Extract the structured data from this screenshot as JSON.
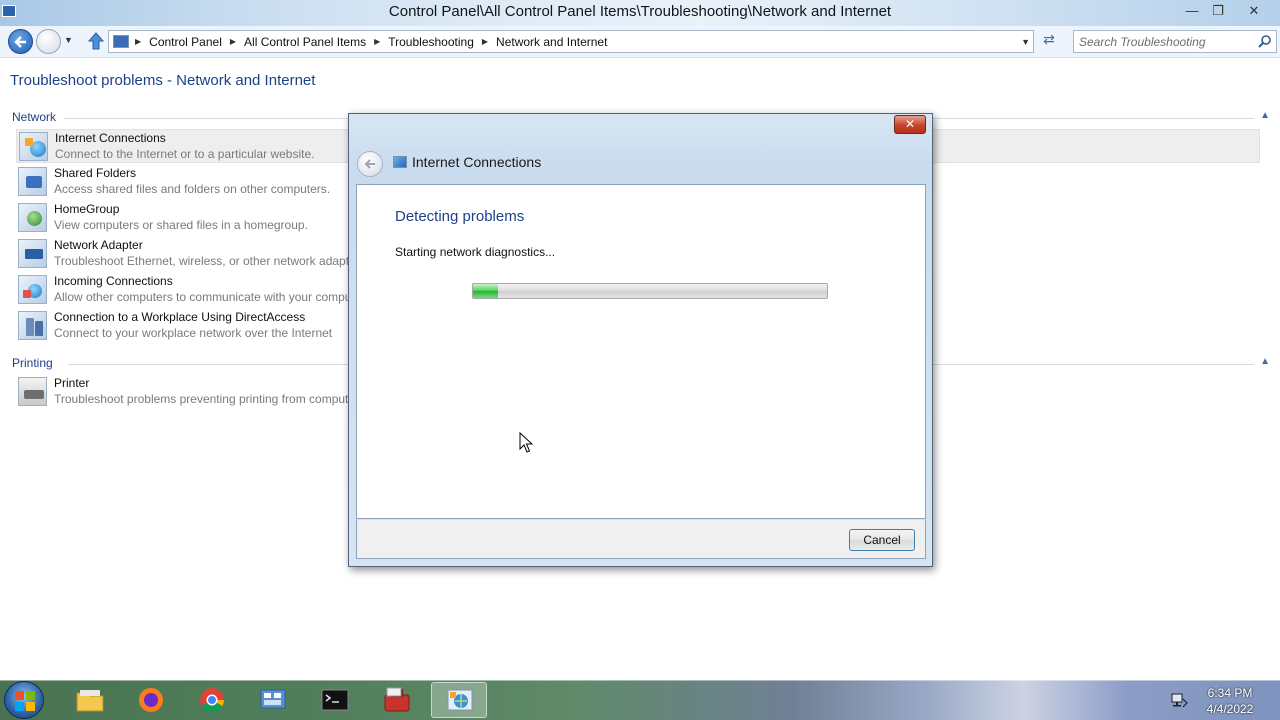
{
  "window": {
    "title": "Control Panel\\All Control Panel Items\\Troubleshooting\\Network and Internet"
  },
  "address_bar": {
    "breadcrumbs": [
      "Control Panel",
      "All Control Panel Items",
      "Troubleshooting",
      "Network and Internet"
    ]
  },
  "search": {
    "placeholder": "Search Troubleshooting"
  },
  "page": {
    "title": "Troubleshoot problems - Network and Internet",
    "groups": [
      {
        "label": "Network",
        "items": [
          {
            "name": "Internet Connections",
            "desc": "Connect to the Internet or to a particular website."
          },
          {
            "name": "Shared Folders",
            "desc": "Access shared files and folders on other computers."
          },
          {
            "name": "HomeGroup",
            "desc": "View computers or shared files in a homegroup."
          },
          {
            "name": "Network Adapter",
            "desc": "Troubleshoot Ethernet, wireless, or other network adapters"
          },
          {
            "name": "Incoming Connections",
            "desc": "Allow other computers to communicate with your computer"
          },
          {
            "name": "Connection to a Workplace Using DirectAccess",
            "desc": "Connect to your workplace network over the Internet"
          }
        ]
      },
      {
        "label": "Printing",
        "items": [
          {
            "name": "Printer",
            "desc": "Troubleshoot problems preventing printing from computer"
          }
        ]
      }
    ]
  },
  "dialog": {
    "title": "Internet Connections",
    "heading": "Detecting problems",
    "status": "Starting network diagnostics...",
    "progress": 0.07,
    "cancel_label": "Cancel"
  },
  "taskbar": {
    "apps": [
      "file-explorer",
      "firefox",
      "chrome",
      "control-panel",
      "command-prompt",
      "toolbox",
      "network-troubleshooter"
    ],
    "time": "6:34 PM",
    "date": "4/4/2022"
  },
  "colors": {
    "link_blue": "#1e3f8a",
    "progress_green": "#25b533",
    "close_red": "#c7432c"
  }
}
